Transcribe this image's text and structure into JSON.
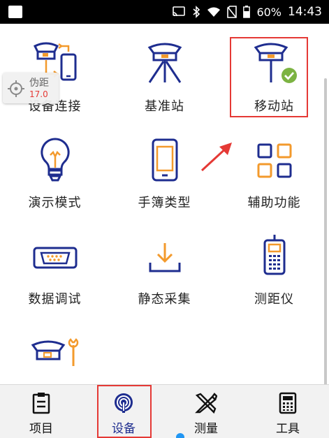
{
  "status_bar": {
    "battery": "60%",
    "time": "14:43"
  },
  "pseudo_range": {
    "label": "伪距",
    "value": "17.0"
  },
  "grid": [
    {
      "label": "设备连接",
      "icon": "device-connect-icon"
    },
    {
      "label": "基准站",
      "icon": "base-station-icon"
    },
    {
      "label": "移动站",
      "icon": "rover-station-icon"
    },
    {
      "label": "演示模式",
      "icon": "lightbulb-icon"
    },
    {
      "label": "手簿类型",
      "icon": "handheld-icon"
    },
    {
      "label": "辅助功能",
      "icon": "grid-squares-icon"
    },
    {
      "label": "数据调试",
      "icon": "serial-port-icon"
    },
    {
      "label": "静态采集",
      "icon": "download-tray-icon"
    },
    {
      "label": "测距仪",
      "icon": "rangefinder-icon"
    },
    {
      "label": "",
      "icon": "receiver-wrench-icon"
    }
  ],
  "nav": [
    {
      "label": "项目",
      "icon": "clipboard-icon"
    },
    {
      "label": "设备",
      "icon": "signal-icon"
    },
    {
      "label": "测量",
      "icon": "ruler-pencil-icon"
    },
    {
      "label": "工具",
      "icon": "calculator-icon"
    }
  ],
  "colors": {
    "navy": "#1e2d8f",
    "orange": "#f39a2c",
    "highlight": "#e53935",
    "check": "#7cb342"
  }
}
